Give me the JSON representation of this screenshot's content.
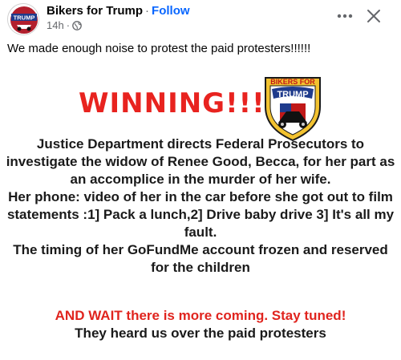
{
  "post": {
    "author": "Bikers for Trump",
    "separator": "·",
    "follow_label": "Follow",
    "time": "14h",
    "time_separator": "·",
    "avatar_text": "TRUMP",
    "caption": "We made enough noise to protest the paid protesters!!!!!!",
    "more_icon": "more-horizontal-icon",
    "close_icon": "close-icon",
    "privacy_icon": "globe-icon"
  },
  "image": {
    "headline": "WINNING!!!",
    "badge_top": "BIKERS FOR",
    "badge_main": "TRUMP",
    "body_lines": [
      "Justice Department directs Federal Prosecutors to",
      "investigate the widow of Renee Good, Becca, for her part as",
      "an accomplice in the murder of her wife.",
      "Her phone: video of her in the car before she got out to film",
      "statements :1] Pack a lunch,2] Drive baby drive 3] It's all my",
      "fault.",
      "The timing of her GoFundMe account frozen and reserved",
      "for the children"
    ],
    "warning": "AND WAIT there is more coming. Stay tuned!",
    "final": "They heard us over the paid protesters"
  },
  "colors": {
    "headline": "#e8231f",
    "follow": "#0866ff",
    "badge_gold": "#f2c230",
    "badge_blue": "#1f3b8c",
    "warning": "#e0241e"
  }
}
